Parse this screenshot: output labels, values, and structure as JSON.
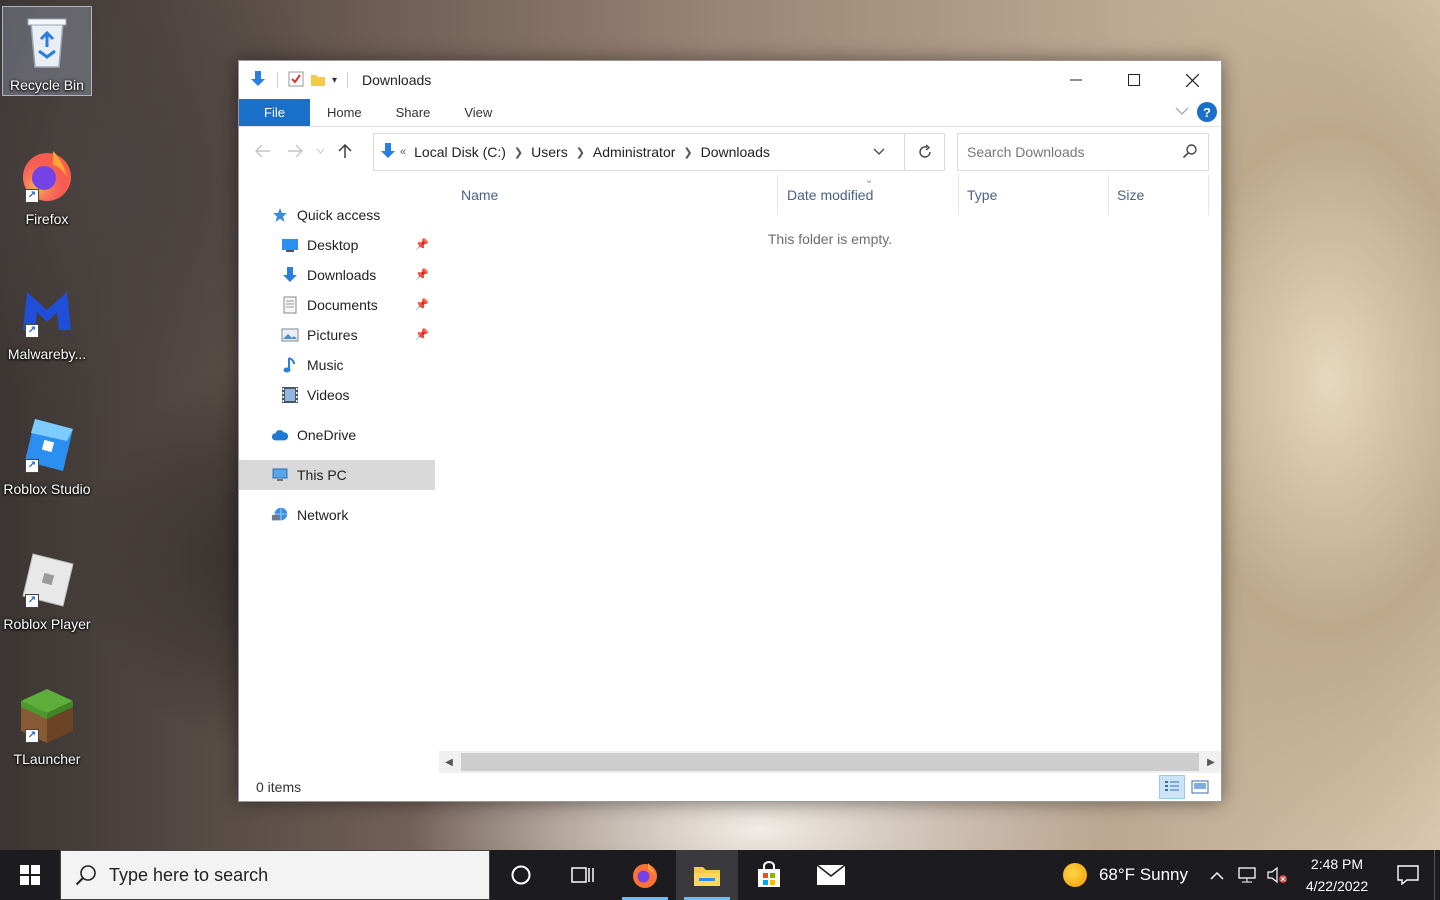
{
  "desktop": {
    "icons": [
      {
        "label": "Recycle Bin"
      },
      {
        "label": "Firefox"
      },
      {
        "label": "Malwareby..."
      },
      {
        "label": "Roblox Studio"
      },
      {
        "label": "Roblox Player"
      },
      {
        "label": "TLauncher"
      }
    ]
  },
  "window": {
    "title": "Downloads",
    "ribbon_tabs": [
      "File",
      "Home",
      "Share",
      "View"
    ],
    "address": {
      "overflow": "«",
      "crumbs": [
        "Local Disk (C:)",
        "Users",
        "Administrator",
        "Downloads"
      ]
    },
    "search": {
      "placeholder": "Search Downloads"
    },
    "sidebar": {
      "quick_access": "Quick access",
      "quick_items": [
        "Desktop",
        "Downloads",
        "Documents",
        "Pictures",
        "Music",
        "Videos"
      ],
      "onedrive": "OneDrive",
      "this_pc": "This PC",
      "network": "Network"
    },
    "columns": [
      "Name",
      "Date modified",
      "Type",
      "Size"
    ],
    "empty_message": "This folder is empty.",
    "status": "0 items"
  },
  "taskbar": {
    "search_placeholder": "Type here to search",
    "weather": "68°F  Sunny",
    "time": "2:48 PM",
    "date": "4/22/2022"
  },
  "colors": {
    "accent": "#1a6fc9",
    "taskbar": "#1c1b1f"
  }
}
